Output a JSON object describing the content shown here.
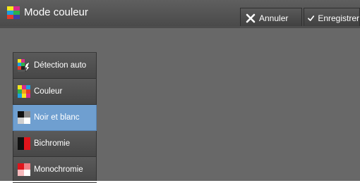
{
  "header": {
    "title": "Mode couleur",
    "icon": "color-mode-icon",
    "cancel_label": "Annuler",
    "save_label": "Enregistrer"
  },
  "menu": {
    "selected_index": 2,
    "items": [
      {
        "label": "Détection auto",
        "icon": "auto-detect-icon"
      },
      {
        "label": "Couleur",
        "icon": "full-color-icon"
      },
      {
        "label": "Noir et blanc",
        "icon": "black-white-icon"
      },
      {
        "label": "Bichromie",
        "icon": "two-color-icon"
      },
      {
        "label": "Monochromie",
        "icon": "single-color-icon"
      }
    ]
  },
  "colors": {
    "background": "#686868",
    "selected": "#6f9fd0",
    "text": "#ffffff"
  }
}
